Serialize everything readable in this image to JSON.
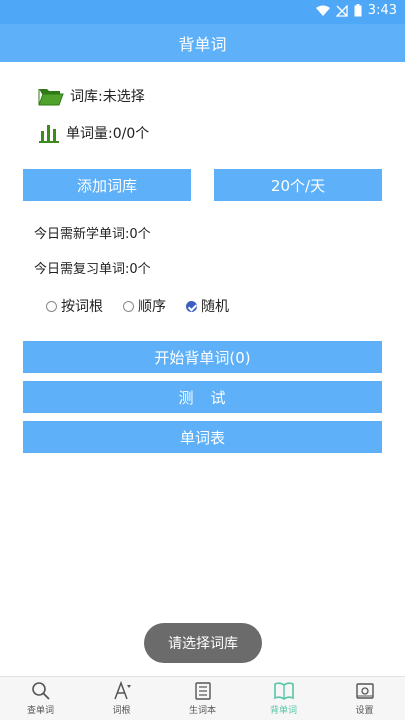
{
  "status_bar": {
    "time": "3:43"
  },
  "title": "背单词",
  "library": {
    "label": "词库:未选择"
  },
  "word_count": {
    "label": "单词量:0/0个"
  },
  "buttons": {
    "add_library": "添加词库",
    "daily_goal": "20个/天",
    "start": "开始背单词(0)",
    "test": "测　试",
    "word_list": "单词表"
  },
  "today": {
    "new_words": "今日需新学单词:0个",
    "review_words": "今日需复习单词:0个"
  },
  "order_options": [
    {
      "label": "按词根",
      "checked": false
    },
    {
      "label": "顺序",
      "checked": false
    },
    {
      "label": "随机",
      "checked": true
    }
  ],
  "toast": "请选择词库",
  "tabs": [
    {
      "label": "查单词",
      "icon": "search-icon",
      "active": false
    },
    {
      "label": "词根",
      "icon": "font-icon",
      "active": false
    },
    {
      "label": "生词本",
      "icon": "notebook-icon",
      "active": false
    },
    {
      "label": "背单词",
      "icon": "book-icon",
      "active": true
    },
    {
      "label": "设置",
      "icon": "settings-icon",
      "active": false
    }
  ],
  "colors": {
    "primary": "#5eb0f8",
    "status_bar": "#4ea8f7",
    "tab_active": "#58c5a6",
    "folder_green": "#3d8b1f",
    "toast_bg": "#6b6b6b"
  }
}
